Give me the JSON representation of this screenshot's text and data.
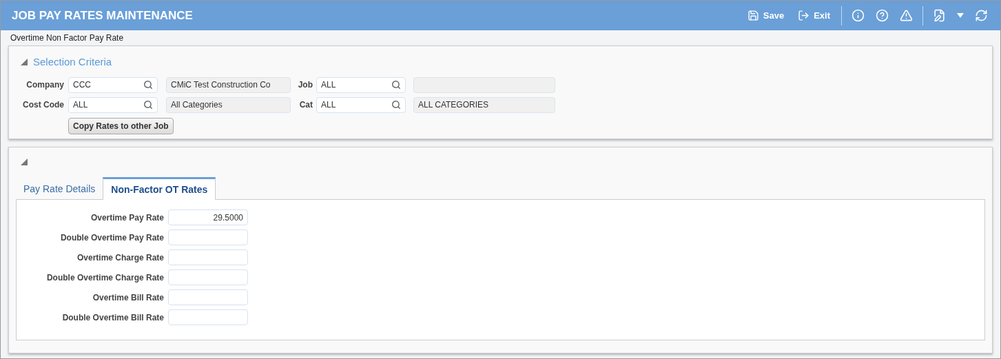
{
  "window": {
    "title": "JOB PAY RATES MAINTENANCE"
  },
  "toolbar": [
    {
      "kind": "save",
      "label": "Save"
    },
    {
      "kind": "exit",
      "label": "Exit"
    },
    {
      "kind": "separator"
    },
    {
      "kind": "info"
    },
    {
      "kind": "help"
    },
    {
      "kind": "warning"
    },
    {
      "kind": "separator"
    },
    {
      "kind": "edit"
    },
    {
      "kind": "dropdown"
    },
    {
      "kind": "refresh"
    }
  ],
  "breadcrumb": "Overtime Non Factor Pay Rate",
  "selection_criteria": {
    "title": "Selection Criteria",
    "rows": [
      {
        "label": "Company",
        "value": "CCC",
        "description": "CMiC Test Construction Co",
        "label_2": "Job",
        "value_2": "ALL",
        "description_2": ""
      },
      {
        "label": "Cost Code",
        "value": "ALL",
        "description": "All Categories",
        "label_2": "Cat",
        "value_2": "ALL",
        "description_2": "ALL CATEGORIES"
      }
    ],
    "button": "Copy Rates to other Job"
  },
  "tabs": [
    {
      "label": "Pay Rate Details",
      "selected": false
    },
    {
      "label": "Non-Factor OT Rates",
      "selected": true
    }
  ],
  "rates": [
    {
      "label": "Overtime Pay Rate",
      "value": "29.5000"
    },
    {
      "label": "Double Overtime Pay Rate"
    },
    {
      "label": "Overtime Charge Rate"
    },
    {
      "label": "Double Overtime Charge Rate"
    },
    {
      "label": "Overtime Bill Rate"
    },
    {
      "label": "Double Overtime Bill Rate"
    }
  ]
}
